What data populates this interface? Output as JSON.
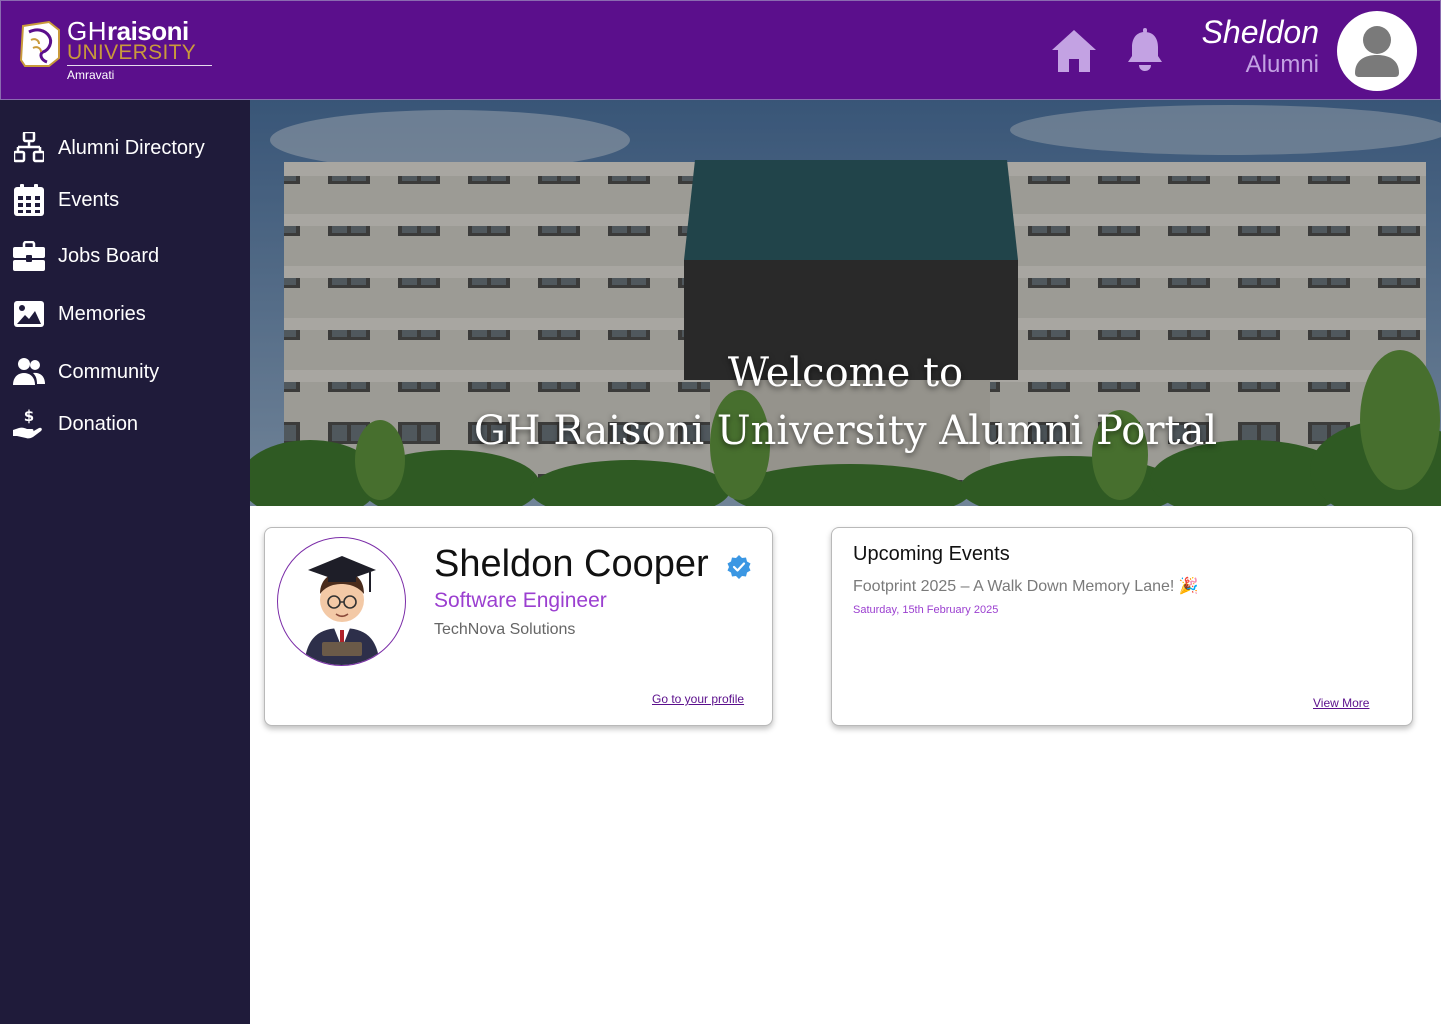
{
  "header": {
    "logo": {
      "gh": "GH",
      "raisoni": "raisoni",
      "university": "UNIVERSITY",
      "city": "Amravati"
    },
    "user": {
      "name": "Sheldon",
      "role": "Alumni"
    },
    "icons": [
      "home-icon",
      "bell-icon",
      "user-avatar-icon"
    ],
    "colors": {
      "bar": "#5b0f8c",
      "icon": "#c3a2e3"
    }
  },
  "sidebar": {
    "background": "#1f1b3a",
    "items": [
      {
        "label": "Alumni Directory",
        "icon": "sitemap-icon"
      },
      {
        "label": "Events",
        "icon": "calendar-icon"
      },
      {
        "label": "Jobs Board",
        "icon": "briefcase-icon"
      },
      {
        "label": "Memories",
        "icon": "image-icon"
      },
      {
        "label": "Community",
        "icon": "users-icon"
      },
      {
        "label": "Donation",
        "icon": "hand-dollar-icon"
      }
    ]
  },
  "hero": {
    "line1": "Welcome to",
    "line2": "GH Raisoni University Alumni Portal"
  },
  "profile_card": {
    "name": "Sheldon Cooper",
    "role": "Software Engineer",
    "company": "TechNova Solutions",
    "link": "Go to your profile",
    "verified_icon": "verified-badge-icon"
  },
  "events_card": {
    "title": "Upcoming Events",
    "events": [
      {
        "name": "Footprint 2025 – A Walk Down Memory Lane! 🎉",
        "date": "Saturday, 15th February 2025"
      }
    ],
    "more": "View More"
  }
}
